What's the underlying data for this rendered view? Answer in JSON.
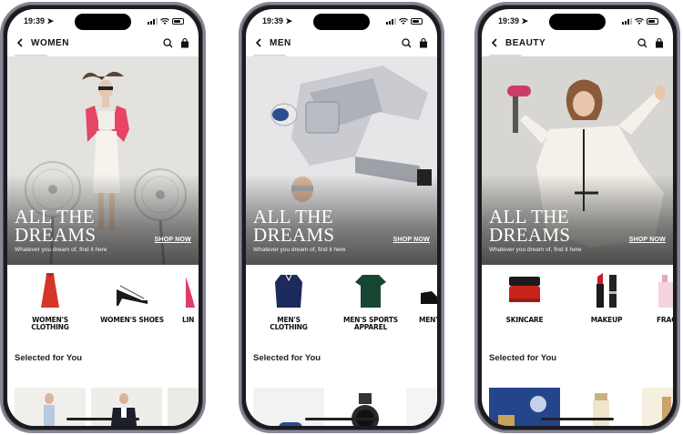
{
  "status": {
    "time": "19:39"
  },
  "hero": {
    "headline_1": "ALL THE",
    "headline_2": "DREAMS",
    "subtitle": "Whatever you dream of, find it here",
    "cta": "SHOP NOW"
  },
  "section_title": "Selected for You",
  "icons": {
    "back": "chevron-left-icon",
    "search": "search-icon",
    "bag": "shopping-bag-icon",
    "location": "location-arrow-icon",
    "signal": "signal-icon",
    "wifi": "wifi-icon",
    "battery": "battery-icon"
  },
  "phones": [
    {
      "nav_title": "WOMEN",
      "categories": [
        {
          "label_1": "WOMEN'S",
          "label_2": "CLOTHING"
        },
        {
          "label_1": "WOMEN'S SHOES",
          "label_2": ""
        },
        {
          "label_1": "LIN",
          "label_2": ""
        }
      ]
    },
    {
      "nav_title": "MEN",
      "categories": [
        {
          "label_1": "MEN'S",
          "label_2": "CLOTHING"
        },
        {
          "label_1": "MEN'S SPORTS",
          "label_2": "APPAREL"
        },
        {
          "label_1": "MEN'S",
          "label_2": ""
        }
      ]
    },
    {
      "nav_title": "BEAUTY",
      "categories": [
        {
          "label_1": "SKINCARE",
          "label_2": ""
        },
        {
          "label_1": "MAKEUP",
          "label_2": ""
        },
        {
          "label_1": "FRAG",
          "label_2": ""
        }
      ]
    }
  ],
  "colors": {
    "frame": "#1b1b1f",
    "bezel": "#8a8598",
    "text": "#111111",
    "hero_text": "#ffffff"
  }
}
